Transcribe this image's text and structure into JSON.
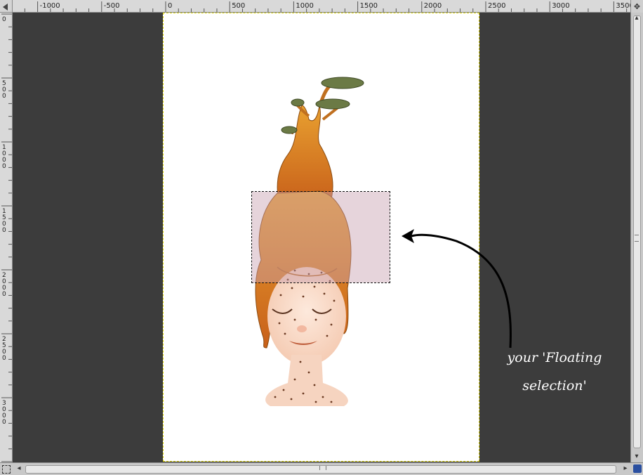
{
  "rulers": {
    "horizontal": [
      "-1000",
      "-500",
      "0",
      "500",
      "1000",
      "1500",
      "2000",
      "2500",
      "3000",
      "3500"
    ],
    "vertical": [
      "0",
      "500",
      "1000",
      "1500",
      "2000",
      "2500",
      "3000"
    ]
  },
  "annotation": {
    "line1": "your 'Floating",
    "line2": "selection'"
  },
  "colors": {
    "workspace": "#3c3c3c",
    "canvas_border": "#d8d000",
    "hair": "#d97c18",
    "tree": "#6b7a45"
  },
  "icons": {
    "navigate": "navigate-icon",
    "quick_mask": "quick-mask-icon",
    "zoom": "zoom-icon",
    "ruler_menu": "ruler-menu-icon"
  }
}
